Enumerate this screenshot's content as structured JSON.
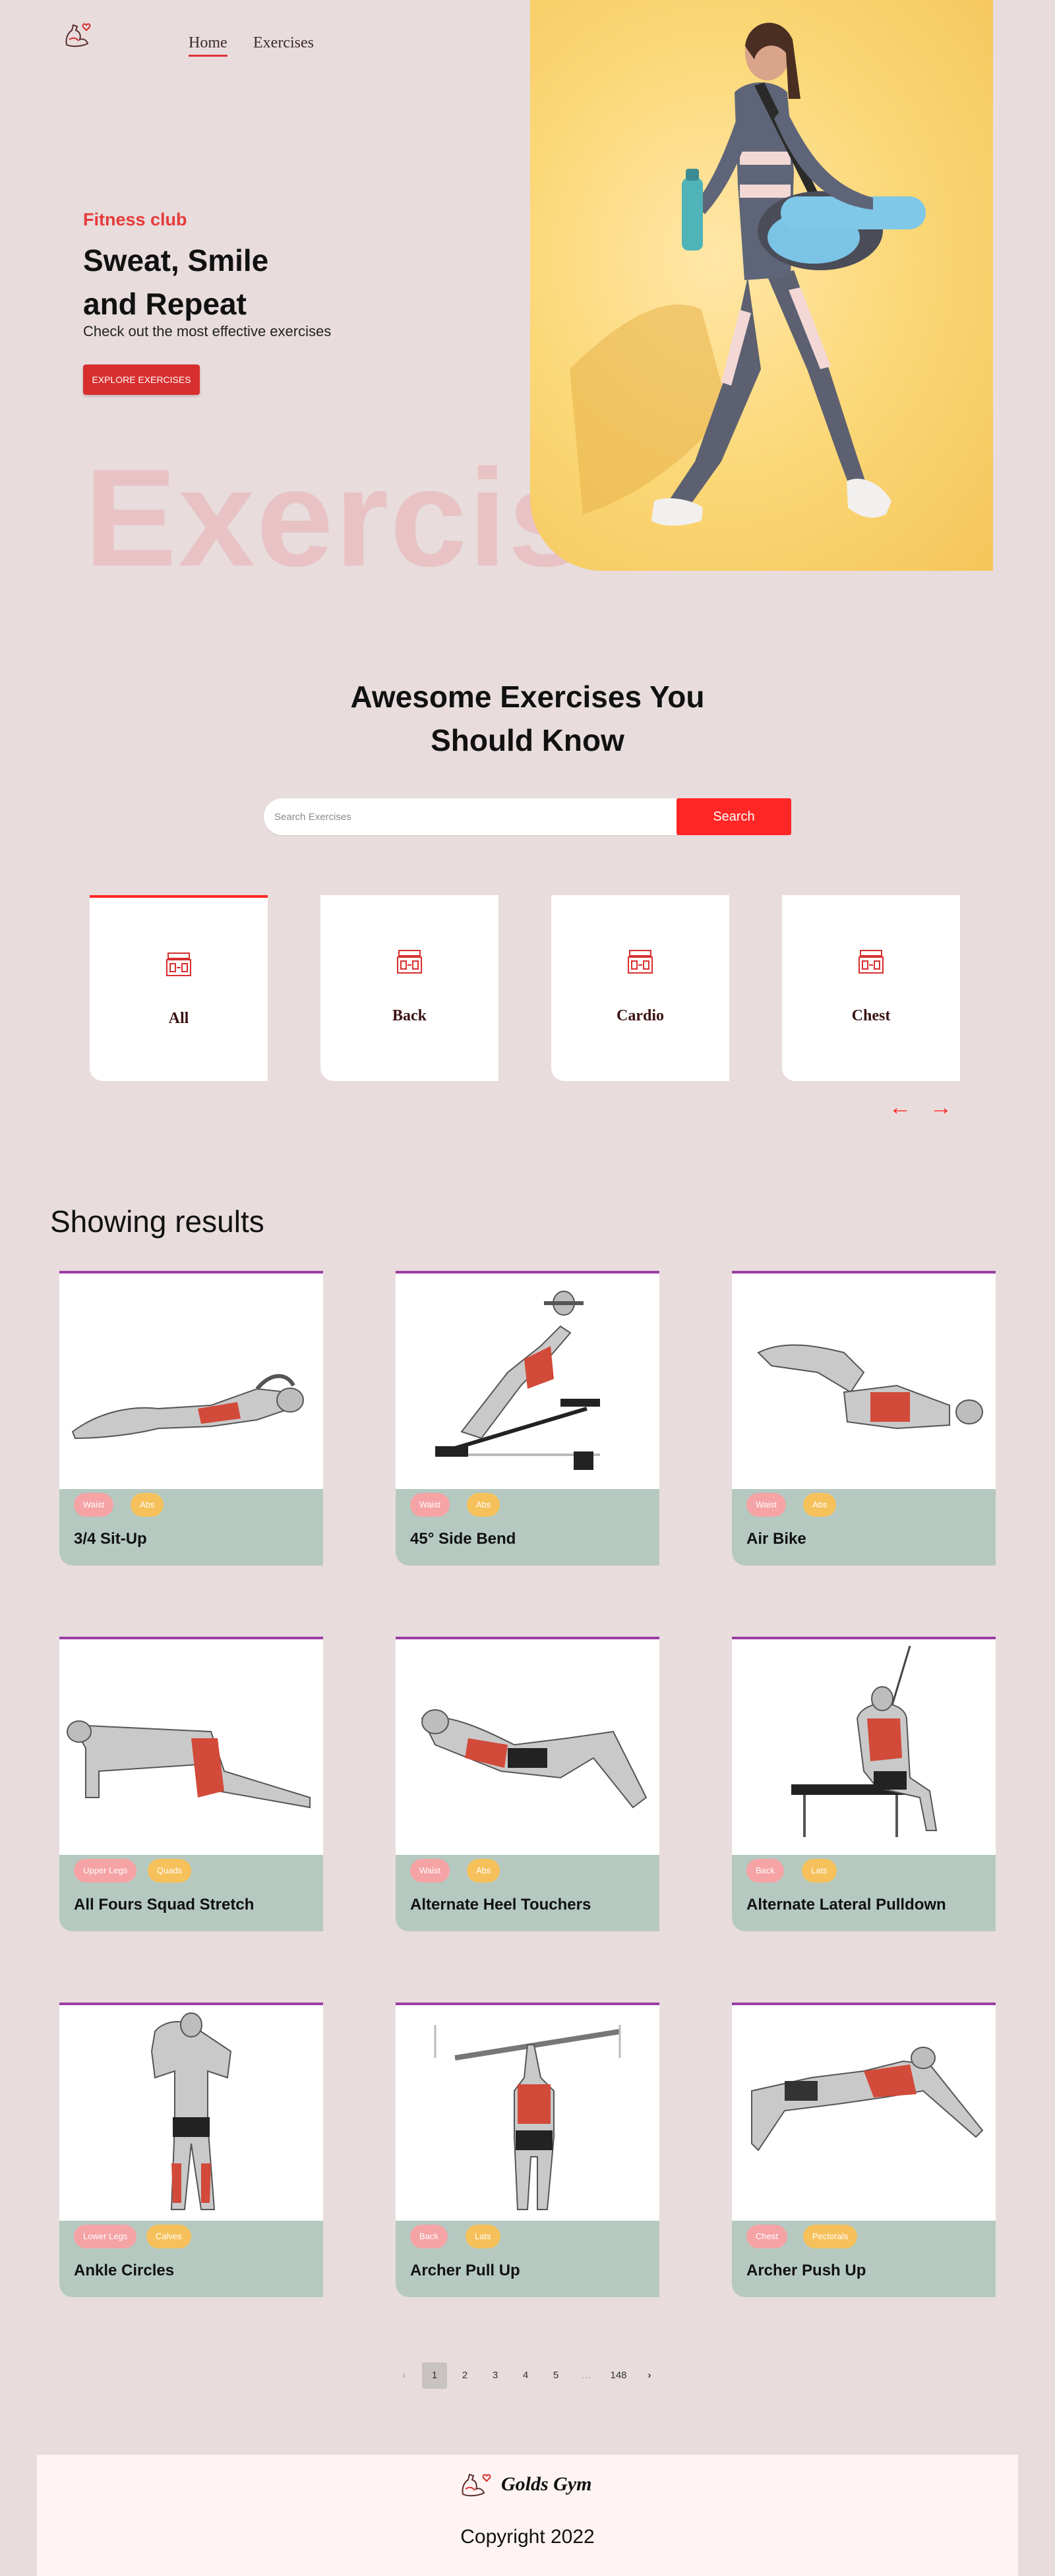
{
  "nav": {
    "home": "Home",
    "exercises": "Exercises"
  },
  "hero": {
    "tag": "Fitness club",
    "title_line1": "Sweat, Smile",
    "title_line2": "and Repeat",
    "subtitle": "Check out the most effective exercises",
    "button": "Explore Exercises",
    "watermark": "Exercise"
  },
  "search": {
    "title_line1": "Awesome Exercises You",
    "title_line2": "Should Know",
    "placeholder": "Search Exercises",
    "button": "Search"
  },
  "categories": [
    {
      "label": "All",
      "icon": "gym-icon",
      "active": true
    },
    {
      "label": "Back",
      "icon": "gym-icon"
    },
    {
      "label": "Cardio",
      "icon": "gym-icon"
    },
    {
      "label": "Chest",
      "icon": "gym-icon"
    }
  ],
  "category_nav": {
    "prev": "←",
    "next": "→"
  },
  "results": {
    "title": "Showing results",
    "cards": [
      {
        "name": "3/4 Sit-Up",
        "tags": [
          "Waist",
          "Abs"
        ]
      },
      {
        "name": "45° Side Bend",
        "tags": [
          "Waist",
          "Abs"
        ]
      },
      {
        "name": "Air Bike",
        "tags": [
          "Waist",
          "Abs"
        ]
      },
      {
        "name": "All Fours Squad Stretch",
        "tags": [
          "Upper Legs",
          "Quads"
        ]
      },
      {
        "name": "Alternate Heel Touchers",
        "tags": [
          "Waist",
          "Abs"
        ]
      },
      {
        "name": "Alternate Lateral Pulldown",
        "tags": [
          "Back",
          "Lats"
        ]
      },
      {
        "name": "Ankle Circles",
        "tags": [
          "Lower Legs",
          "Calves"
        ]
      },
      {
        "name": "Archer Pull Up",
        "tags": [
          "Back",
          "Lats"
        ]
      },
      {
        "name": "Archer Push Up",
        "tags": [
          "Chest",
          "Pectorals"
        ]
      }
    ]
  },
  "pagination": {
    "prev": "‹",
    "pages": [
      "1",
      "2",
      "3",
      "4",
      "5",
      "…",
      "148"
    ],
    "current": "1",
    "next": "›"
  },
  "footer": {
    "brand": "Golds Gym",
    "copyright": "Copyright 2022"
  },
  "colors": {
    "accent": "#ff2625",
    "background": "#e8dcdd",
    "card_footer": "#b5c9c1",
    "card_border": "#9a3fa3"
  }
}
